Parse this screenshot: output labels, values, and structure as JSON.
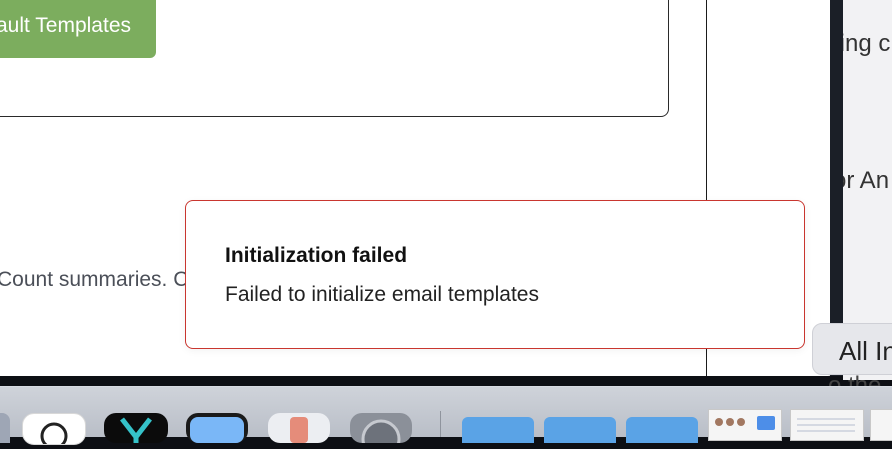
{
  "main": {
    "button_label": "Default Templates",
    "summary_text": "Count summaries. C"
  },
  "toast": {
    "title": "Initialization failed",
    "message": "Failed to initialize email templates"
  },
  "background_window": {
    "text_top": "ting c",
    "text_middle": "or An",
    "floating_button_label": "All In",
    "peek_text": "o the"
  },
  "colors": {
    "button_green": "#7cad5e",
    "toast_border": "#c9362f"
  },
  "dock": {
    "icons": [
      "app-icon",
      "chatgpt-icon",
      "kanban-app-icon",
      "preview-app-icon",
      "iphone-mirroring-icon",
      "system-settings-icon",
      "folder-icon",
      "folder-icon",
      "folder-icon",
      "screenshot-thumbnail",
      "document-thumbnail",
      "document-thumbnail"
    ]
  }
}
